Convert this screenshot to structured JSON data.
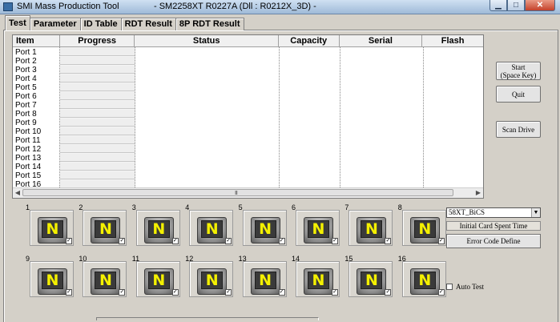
{
  "window": {
    "title": "SMI Mass Production Tool",
    "subtitle": "- SM2258XT    R0227A     (Dll : R0212X_3D) -",
    "min_glyph": "▁",
    "max_glyph": "□",
    "close_glyph": "✕"
  },
  "tabs": [
    "Test",
    "Parameter",
    "ID Table",
    "RDT Result",
    "8P RDT Result"
  ],
  "grid": {
    "columns": [
      "Item",
      "Progress",
      "Status",
      "Capacity",
      "Serial",
      "Flash"
    ],
    "ports": [
      "Port 1",
      "Port 2",
      "Port 3",
      "Port 4",
      "Port 5",
      "Port 6",
      "Port 7",
      "Port 8",
      "Port 9",
      "Port 10",
      "Port 11",
      "Port 12",
      "Port 13",
      "Port 14",
      "Port 15",
      "Port 16"
    ],
    "scroll_left": "◀",
    "scroll_right": "▶",
    "scroll_grip": "III"
  },
  "buttons": {
    "start": "Start\n(Space Key)",
    "quit": "Quit",
    "scan": "Scan Drive",
    "error_code": "Error Code Define"
  },
  "drives": {
    "labels": [
      "1",
      "2",
      "3",
      "4",
      "5",
      "6",
      "7",
      "8",
      "9",
      "10",
      "11",
      "12",
      "13",
      "14",
      "15",
      "16"
    ],
    "glyph": "N",
    "check": "✓"
  },
  "flash_select": {
    "value": "58XT_BiCS",
    "arrow": "▼"
  },
  "status_text": "Initial Card Spent Time",
  "auto_test": "Auto Test",
  "colors": {
    "drive_glyph": "#f4f000",
    "title_bar": "#9fbad8",
    "close_button": "#c4412a"
  }
}
